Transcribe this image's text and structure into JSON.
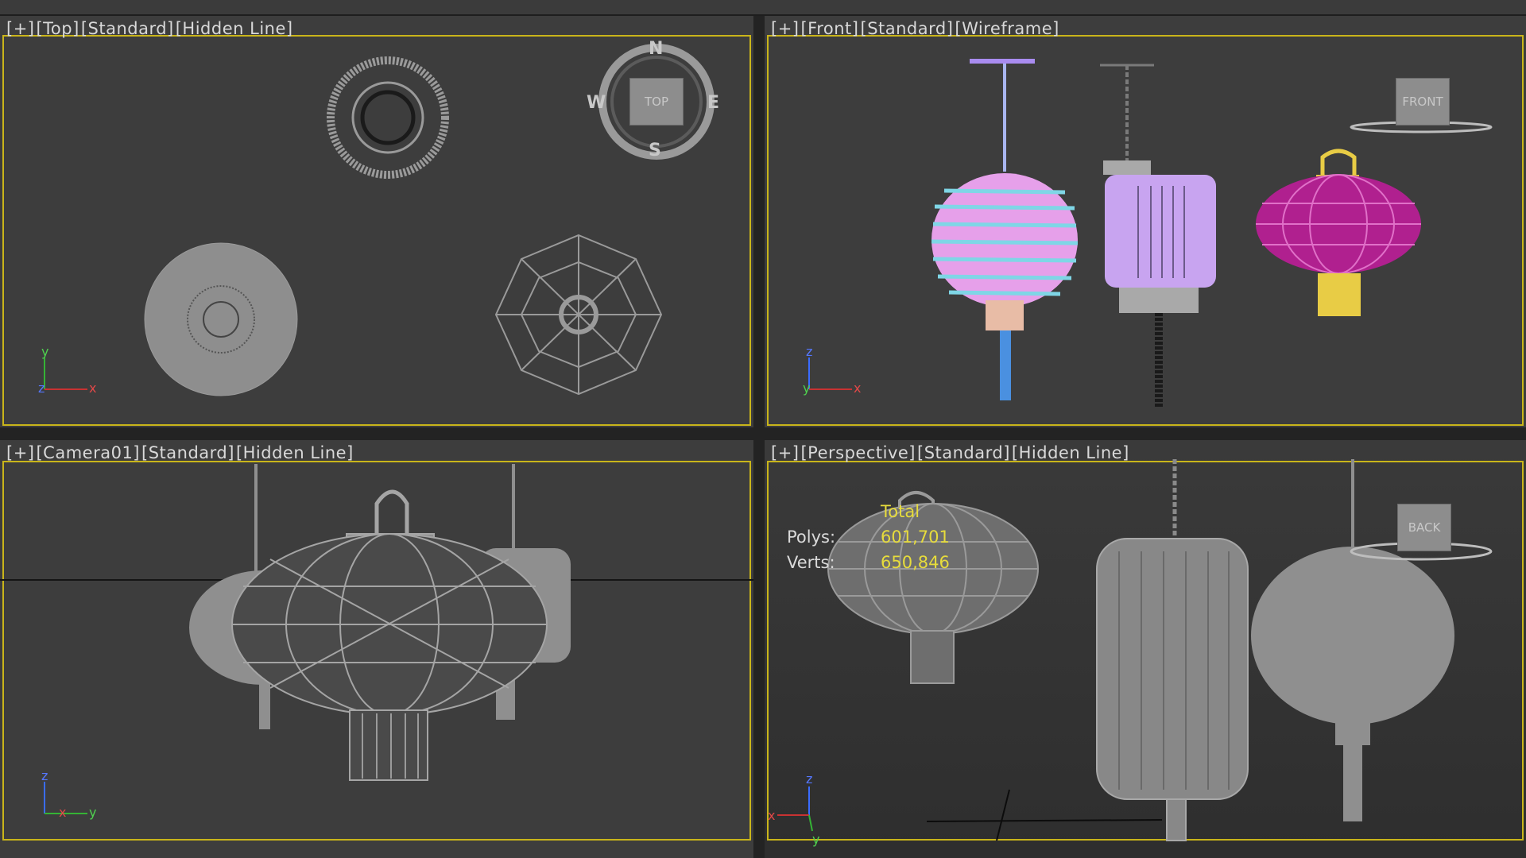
{
  "viewports": {
    "top": {
      "labels": [
        "[+]",
        "[Top]",
        "[Standard]",
        "[Hidden Line]"
      ],
      "compass": {
        "n": "N",
        "s": "S",
        "e": "E",
        "w": "W",
        "cube": "TOP"
      }
    },
    "front": {
      "labels": [
        "[+]",
        "[Front]",
        "[Standard]",
        "[Wireframe]"
      ],
      "cube": "FRONT"
    },
    "camera": {
      "labels": [
        "[+]",
        "[Camera01]",
        "[Standard]",
        "[Hidden Line]"
      ]
    },
    "perspective": {
      "labels": [
        "[+]",
        "[Perspective]",
        "[Standard]",
        "[Hidden Line]"
      ],
      "cube": "BACK",
      "stats": {
        "header": "Total",
        "polys_label": "Polys:",
        "polys": "601,701",
        "verts_label": "Verts:",
        "verts": "650,846"
      }
    }
  },
  "axes": {
    "top": [
      "y",
      "z",
      "x"
    ],
    "front": [
      "z",
      "y",
      "x"
    ],
    "camera": [
      "z",
      "x",
      "y"
    ],
    "perspective": [
      "z",
      "x",
      "y"
    ]
  },
  "colors": {
    "frame": "#c9b51a",
    "lantern_blue": "#7fd6e6",
    "lantern_pink": "#e6a0ea",
    "lantern_purple": "#c8a4f0",
    "lantern_magenta": "#b0208f",
    "lantern_gold": "#e8cc45",
    "wire": "#9a9a9a"
  }
}
